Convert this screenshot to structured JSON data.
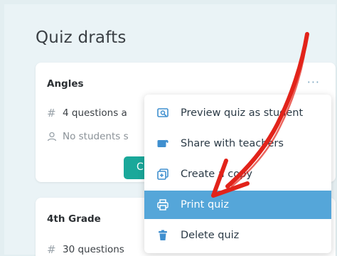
{
  "page": {
    "title": "Quiz drafts"
  },
  "cards": [
    {
      "title": "Angles",
      "questions": "4 questions a",
      "students": "No students s",
      "button_label": "C"
    },
    {
      "title": "4th Grade",
      "questions": "30 questions"
    }
  ],
  "menu": {
    "items": [
      {
        "label": "Preview quiz as student",
        "icon": "preview-icon"
      },
      {
        "label": "Share with teachers",
        "icon": "share-icon"
      },
      {
        "label": "Create a copy",
        "icon": "copy-icon"
      },
      {
        "label": "Print quiz",
        "icon": "print-icon",
        "active": true
      },
      {
        "label": "Delete quiz",
        "icon": "trash-icon"
      }
    ]
  },
  "colors": {
    "accent_teal": "#1aa89a",
    "highlight_blue": "#55a6d9",
    "annotation_red": "#e2231a"
  }
}
